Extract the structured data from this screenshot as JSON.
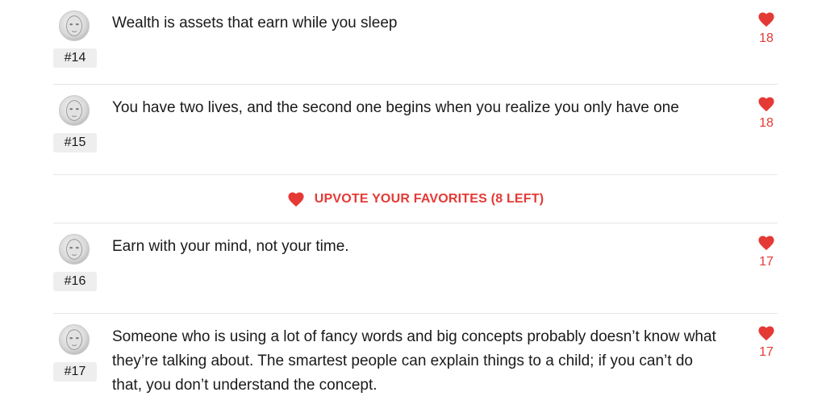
{
  "quotes": [
    {
      "rank": "#14",
      "text": "Wealth is assets that earn while you sleep",
      "votes": "18"
    },
    {
      "rank": "#15",
      "text": "You have two lives, and the second one begins when you realize you only have one",
      "votes": "18"
    },
    {
      "rank": "#16",
      "text": "Earn with your mind, not your time.",
      "votes": "17"
    },
    {
      "rank": "#17",
      "text": "Someone who is using a lot of fancy words and big concepts probably doesn’t know what they’re talking about. The smartest people can explain things to a child; if you can’t do that, you don’t understand the concept.",
      "votes": "17"
    }
  ],
  "banner": {
    "label": "UPVOTE YOUR FAVORITES (8 LEFT)",
    "icon": "heart-icon"
  },
  "colors": {
    "accent": "#e53935",
    "badge_bg": "#eeeeee",
    "divider": "#e6e6e6"
  },
  "icons": {
    "vote": "heart-icon",
    "avatar": "avatar-face-icon"
  }
}
